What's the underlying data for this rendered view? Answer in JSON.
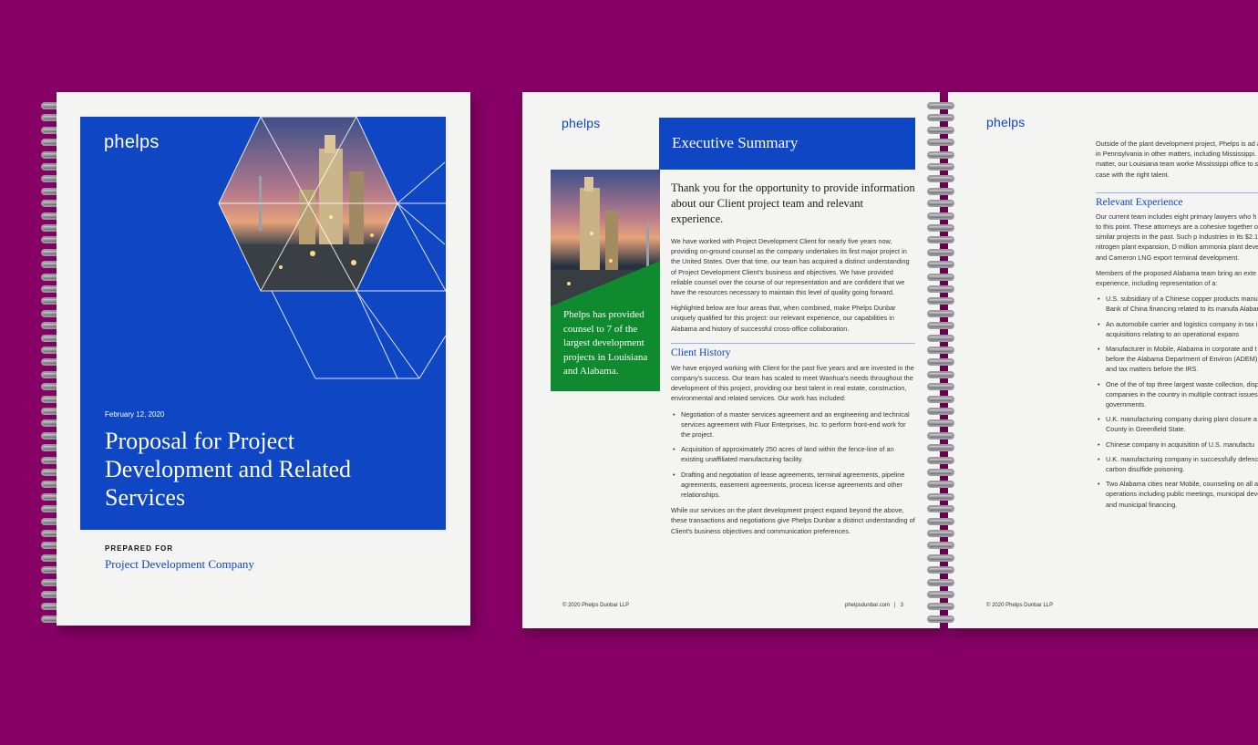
{
  "cover": {
    "logo": "phelps",
    "date": "February 12, 2020",
    "title": "Proposal for Project Development and Related Services",
    "prepared_for_label": "PREPARED  FOR",
    "client": "Project Development Company"
  },
  "spread_left": {
    "logo": "phelps",
    "heading": "Executive Summary",
    "callout": "Phelps has provided counsel to 7 of the largest development projects in Louisiana and Alabama.",
    "lead": "Thank you for the opportunity to provide information about our Client project team and relevant experience.",
    "para1": "We have worked with Project Development Client for nearly five years now, providing on-ground counsel as the company undertakes its first major project in the United States. Over that time, our team has acquired a distinct understanding of Project Development Client's business and objectives. We have provided reliable counsel over the course of our representation and are confident that we have the resources necessary to maintain this level of quality going forward.",
    "para2": "Highlighted below are four areas that, when combined, make Phelps Dunbar uniquely qualified for this project: our relevant experience, our capabilities in Alabama and history of successful cross-office collaboration.",
    "section_title": "Client History",
    "para3": "We have enjoyed working with Client for the past five years and are invested in the company's success. Our team has scaled to meet Wanhua's needs throughout the development of this project, providing our best talent in real estate, construction, environmental and related services. Our work has included:",
    "bullets": [
      "Negotiation of a master services agreement and an engineering and technical services agreement with Fluor Enterprises, Inc. to perform front-end work for the project.",
      "Acquisition of approximately 250 acres of land within the fence-line of an existing unaffiliated manufacturing facility.",
      "Drafting and negotiation of lease agreements, terminal agreements, pipeline agreements, easement agreements, process license agreements and other relationships."
    ],
    "para4": "While our services on the plant development project expand beyond the above, these transactions and negotiations give Phelps Dunbar a distinct understanding of Client's business objectives and communication preferences.",
    "footer_left": "© 2020 Phelps Dunbar LLP",
    "footer_right": "phelpsdunbar.com   |   3"
  },
  "spread_right": {
    "logo": "phelps",
    "intro": "Outside of the plant development project, Phelps is ad an affiliate in Pennsylvania in other matters, including Mississippi. For that matter, our Louisiana team worke Mississippi office to staff the case with the right talent.",
    "section_title": "Relevant Experience",
    "para1": "Our current team includes eight primary lawyers who h Client up to this point. These attorneys are a cohesive together on several similar projects in the past. Such p Industries in its $2.1 billion nitrogen plant expansion, D million ammonia plant development and Cameron LNG export terminal development.",
    "para2": "Members of the proposed Alabama team bring an exte relevant experience, including representation of a:",
    "bullets": [
      "U.S. subsidiary of a Chinese copper products manu Import Bank of China financing related to its manufa Alabama.",
      "An automobile carrier and logistics company in tax i estate acquisitions relating to an operational expans",
      "Manufacturer in Mobile, Alabama in corporate and t matters before the Alabama Department of Environ (ADEM) and EPA and tax matters before the IRS.",
      "One of the of top three largest waste collection, disp companies in the country in multiple contract issues governments.",
      "U.K. manufacturing company during plant closure a to Mobile County in Greenfield State.",
      "Chinese company in acquisition of U.S. manufactu",
      "U.K. manufacturing company in successfully defenc involving carbon disulfide poisoning.",
      "Two Alabama cities near Mobile, counseling on all a city operations including public meetings, municipal development and municipal financing."
    ],
    "footer_left": "© 2020 Phelps Dunbar LLP"
  },
  "colors": {
    "background": "#870066",
    "brand_blue": "#0f46c4",
    "callout_green": "#0f8a2e",
    "paper": "#f4f4f2"
  }
}
